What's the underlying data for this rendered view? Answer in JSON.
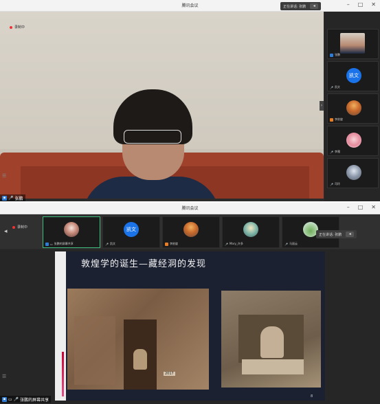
{
  "window1": {
    "title": "腾讯会议",
    "speaking": "正在讲话: 张鹏",
    "recording": "录制中",
    "main_name": "张鹏",
    "participants": [
      {
        "name": "张鹏",
        "avatar": "photo"
      },
      {
        "name": "凯文",
        "avatar_text": "凯文"
      },
      {
        "name": "李依旋",
        "avatar": "photo"
      },
      {
        "name": "李雅",
        "avatar": "photo"
      },
      {
        "name": "司玲",
        "avatar": "photo"
      }
    ]
  },
  "window2": {
    "title": "腾讯会议",
    "speaking": "正在讲话: 张鹏",
    "recording": "录制中",
    "tiles": [
      {
        "name": "张鹏的屏幕共享",
        "avatar": "photo"
      },
      {
        "name": "凯文",
        "avatar_text": "凯文"
      },
      {
        "name": "李依旋",
        "avatar": "photo"
      },
      {
        "name": "Mary_许多",
        "avatar": "photo"
      },
      {
        "name": "马丽云",
        "avatar": "photo"
      }
    ],
    "slide_title": "敦煌学的诞生—藏经洞的发现",
    "photo_tag": "2017",
    "slide_page": "8",
    "share_name": "张鹏的屏幕共享"
  },
  "colors": {
    "accent": "#1a73e8",
    "active_border": "#3fbf7f",
    "record_dot": "#e33"
  },
  "icons": [
    "minimize-icon",
    "maximize-icon",
    "close-icon",
    "menu-icon",
    "mic-icon",
    "screen-share-icon",
    "chevron-left-icon"
  ]
}
